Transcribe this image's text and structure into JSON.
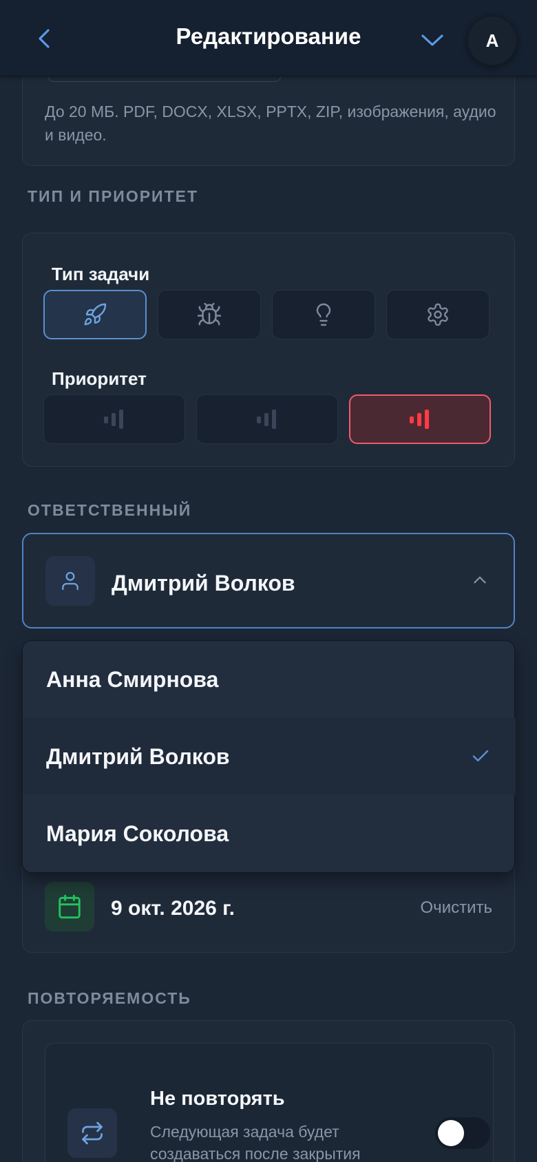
{
  "header": {
    "title": "Редактирование",
    "avatar_initial": "А"
  },
  "attachments": {
    "hint": "До 20 МБ. PDF, DOCX, XLSX, PPTX, ZIP, изображения, аудио и видео."
  },
  "type_priority": {
    "section_label": "ТИП И ПРИОРИТЕТ",
    "type_label": "Тип задачи",
    "types": [
      {
        "icon": "rocket-icon",
        "selected": true
      },
      {
        "icon": "bug-icon",
        "selected": false
      },
      {
        "icon": "lightbulb-icon",
        "selected": false
      },
      {
        "icon": "gear-icon",
        "selected": false
      }
    ],
    "priority_label": "Приоритет",
    "priorities": [
      {
        "level": 1,
        "selected": false
      },
      {
        "level": 2,
        "selected": false
      },
      {
        "level": 3,
        "selected": true,
        "color": "#ff3b45"
      }
    ]
  },
  "assignee": {
    "section_label": "ОТВЕТСТВЕННЫЙ",
    "selected_name": "Дмитрий Волков",
    "options": [
      {
        "name": "Анна Смирнова",
        "selected": false
      },
      {
        "name": "Дмитрий Волков",
        "selected": true
      },
      {
        "name": "Мария Соколова",
        "selected": false
      }
    ]
  },
  "due_date": {
    "value": "9 окт. 2026 г.",
    "clear_label": "Очистить"
  },
  "recurrence": {
    "section_label": "ПОВТОРЯЕМОСТЬ",
    "title": "Не повторять",
    "description": "Следующая задача будет создаваться после закрытия текущей.",
    "enabled": false
  },
  "colors": {
    "accent": "#5a8fd0",
    "danger": "#ff3b45",
    "success": "#22c55e"
  }
}
